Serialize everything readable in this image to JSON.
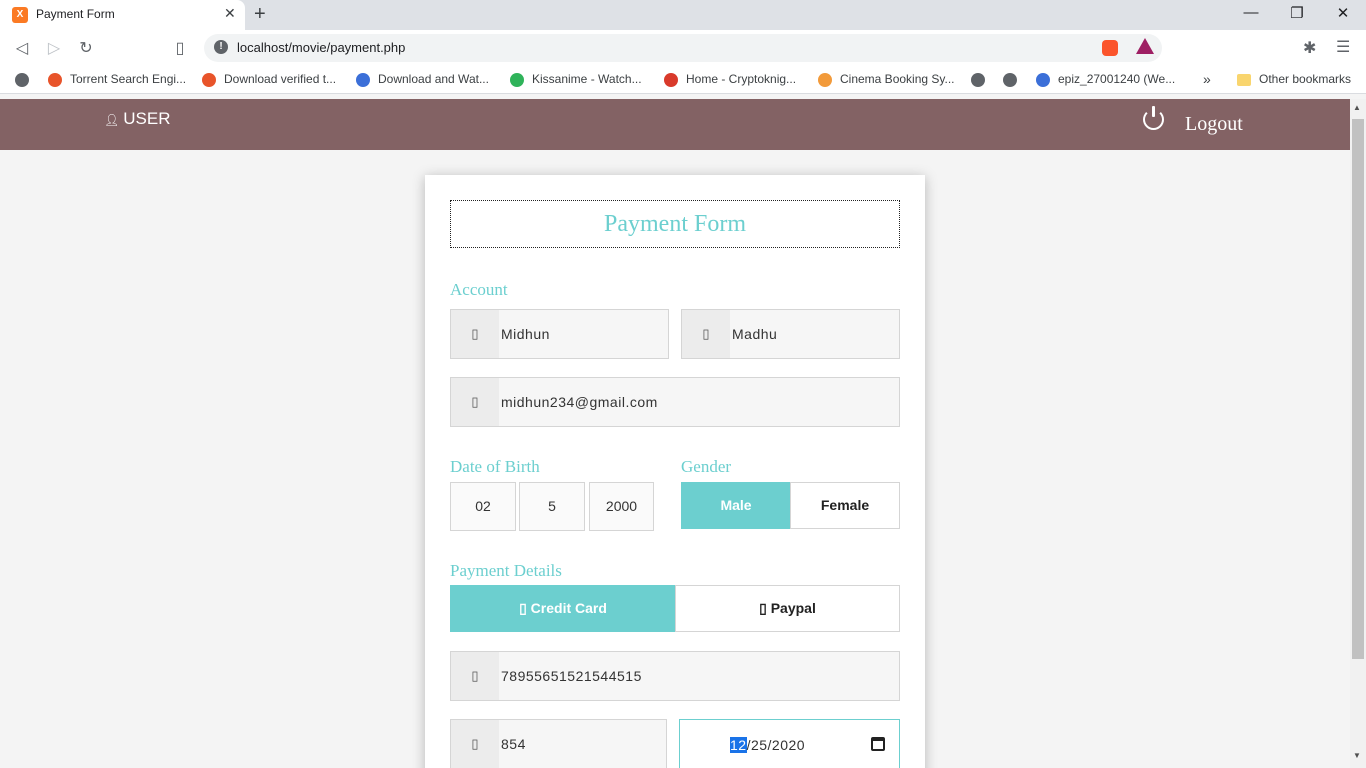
{
  "browser": {
    "tab_title": "Payment Form",
    "url": "localhost/movie/payment.php",
    "bookmarks": [
      {
        "label": "Torrent Search Engi...",
        "color": "#e8542a"
      },
      {
        "label": "Download verified t...",
        "color": "#e8542a"
      },
      {
        "label": "Download and Wat...",
        "color": "#3b6fd8"
      },
      {
        "label": "Kissanime - Watch...",
        "color": "#2fb35a"
      },
      {
        "label": "Home - Cryptoknig...",
        "color": "#d93a2b"
      },
      {
        "label": "Cinema Booking Sy...",
        "color": "#f29a3a"
      },
      {
        "label": "epiz_27001240 (We...",
        "color": "#3b6fd8"
      }
    ],
    "other_bookmarks": "Other bookmarks"
  },
  "nav": {
    "user_label": "USER",
    "logout_label": "Logout"
  },
  "form": {
    "title": "Payment Form",
    "account_label": "Account",
    "first_name": "Midhun",
    "last_name": "Madhu",
    "email": "midhun234@gmail.com",
    "dob_label": "Date of Birth",
    "dob_day": "02",
    "dob_month": "5",
    "dob_year": "2000",
    "gender_label": "Gender",
    "gender_options": [
      "Male",
      "Female"
    ],
    "gender_selected": "Male",
    "payment_label": "Payment Details",
    "payment_options": [
      "Credit Card",
      "Paypal"
    ],
    "payment_selected": "Credit Card",
    "card_number": "78955651521544515",
    "cvv": "854",
    "expiry_month": "12",
    "expiry_rest": "/25/2020"
  },
  "colors": {
    "accent": "#6ccfcf",
    "navbar": "#836264"
  }
}
